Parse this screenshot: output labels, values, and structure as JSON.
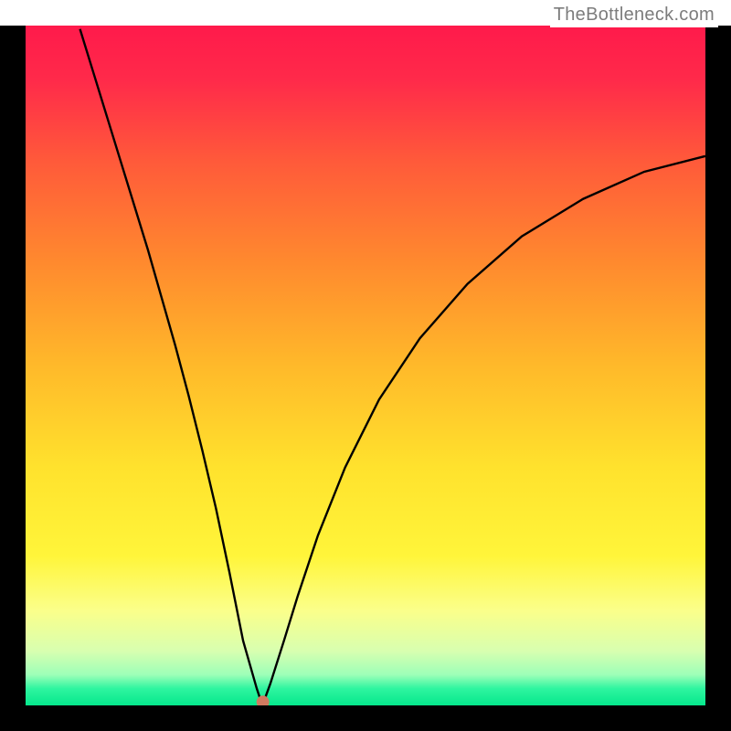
{
  "watermark": "TheBottleneck.com",
  "chart_data": {
    "type": "line",
    "title": "",
    "xlabel": "",
    "ylabel": "",
    "xlim": [
      0,
      1
    ],
    "ylim": [
      0,
      1
    ],
    "background_gradient": {
      "stops": [
        {
          "offset": 0.0,
          "color": "#ff1a4b"
        },
        {
          "offset": 0.08,
          "color": "#ff2a4a"
        },
        {
          "offset": 0.2,
          "color": "#ff5a3a"
        },
        {
          "offset": 0.35,
          "color": "#ff8a2e"
        },
        {
          "offset": 0.5,
          "color": "#ffb92a"
        },
        {
          "offset": 0.65,
          "color": "#ffe22d"
        },
        {
          "offset": 0.78,
          "color": "#fff53a"
        },
        {
          "offset": 0.86,
          "color": "#fbff8a"
        },
        {
          "offset": 0.92,
          "color": "#d8ffb0"
        },
        {
          "offset": 0.955,
          "color": "#9dffb8"
        },
        {
          "offset": 0.975,
          "color": "#2ff5a0"
        },
        {
          "offset": 1.0,
          "color": "#05e88c"
        }
      ]
    },
    "series": [
      {
        "name": "bottleneck-curve",
        "color": "#000000",
        "x": [
          0.08,
          0.1,
          0.12,
          0.14,
          0.16,
          0.18,
          0.2,
          0.22,
          0.24,
          0.26,
          0.28,
          0.3,
          0.32,
          0.34,
          0.345,
          0.349,
          0.352,
          0.36,
          0.38,
          0.4,
          0.43,
          0.47,
          0.52,
          0.58,
          0.65,
          0.73,
          0.82,
          0.91,
          1.0
        ],
        "y": [
          0.995,
          0.93,
          0.865,
          0.8,
          0.735,
          0.67,
          0.6,
          0.53,
          0.455,
          0.375,
          0.29,
          0.195,
          0.095,
          0.025,
          0.01,
          0.005,
          0.01,
          0.032,
          0.095,
          0.16,
          0.25,
          0.35,
          0.45,
          0.54,
          0.62,
          0.69,
          0.745,
          0.785,
          0.808
        ]
      }
    ],
    "marker": {
      "x": 0.349,
      "y": 0.005,
      "color": "#d07a60",
      "radius": 7
    }
  }
}
